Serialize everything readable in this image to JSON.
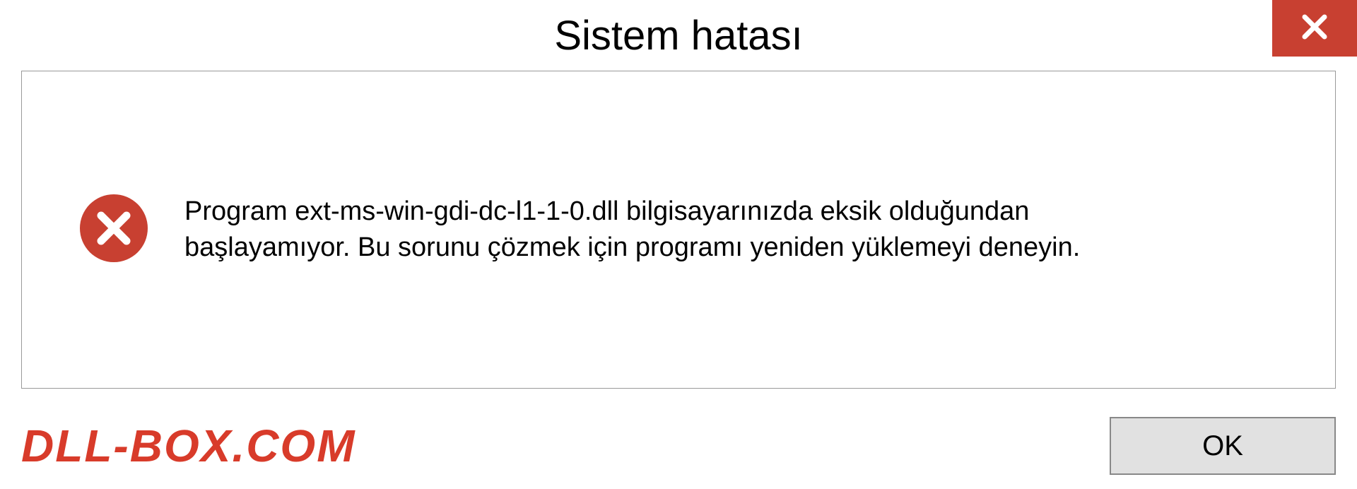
{
  "dialog": {
    "title": "Sistem hatası",
    "message": "Program ext-ms-win-gdi-dc-l1-1-0.dll bilgisayarınızda eksik olduğundan başlayamıyor. Bu sorunu çözmek için programı yeniden yüklemeyi deneyin.",
    "ok_label": "OK"
  },
  "watermark": "DLL-BOX.COM"
}
